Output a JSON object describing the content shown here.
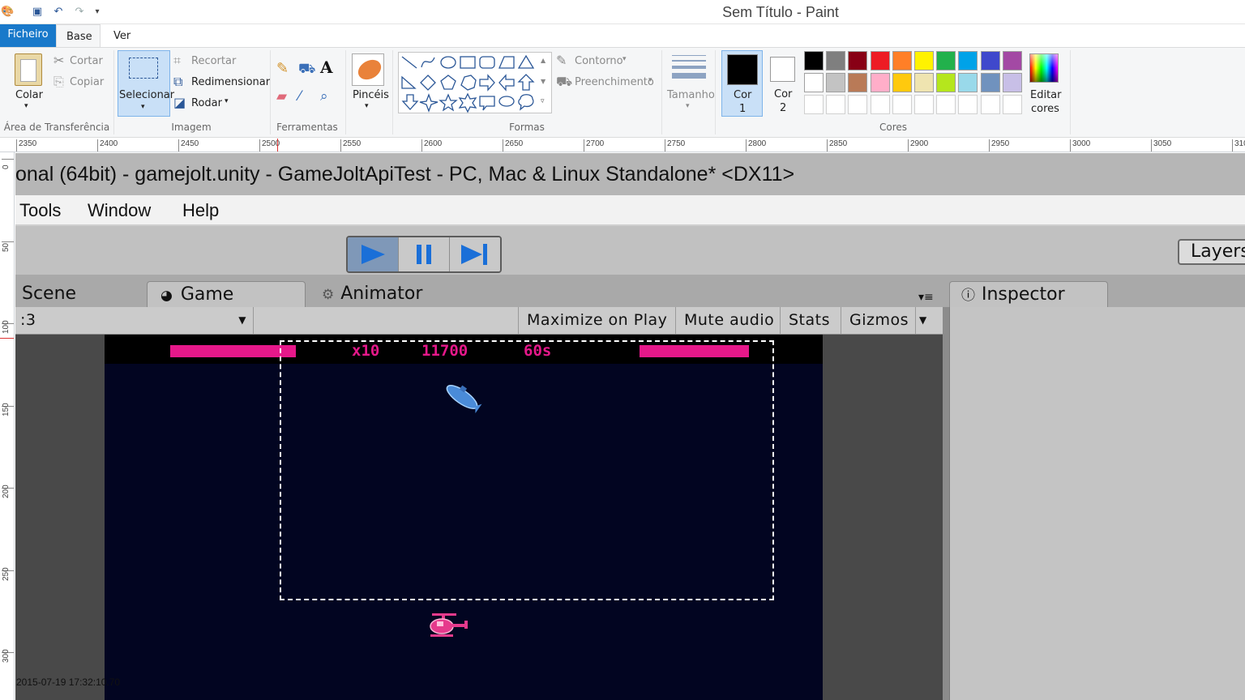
{
  "window": {
    "title": "Sem Título - Paint"
  },
  "ribbon_tabs": {
    "file": "Ficheiro",
    "home": "Base",
    "view": "Ver"
  },
  "clipboard": {
    "paste": "Colar",
    "cut": "Cortar",
    "copy": "Copiar",
    "group": "Área de Transferência"
  },
  "image": {
    "select": "Selecionar",
    "crop": "Recortar",
    "resize": "Redimensionar",
    "rotate": "Rodar",
    "group": "Imagem"
  },
  "tools": {
    "group": "Ferramentas"
  },
  "brushes": {
    "label": "Pincéis"
  },
  "shapes": {
    "outline": "Contorno",
    "fill": "Preenchimento",
    "group": "Formas"
  },
  "size": {
    "label": "Tamanho"
  },
  "colors": {
    "color1": "Cor\n1",
    "color1_a": "Cor",
    "color1_b": "1",
    "color2_a": "Cor",
    "color2_b": "2",
    "edit_a": "Editar",
    "edit_b": "cores",
    "group": "Cores",
    "color1_value": "#000000",
    "color2_value": "#ffffff",
    "row1": [
      "#000000",
      "#7f7f7f",
      "#880015",
      "#ed1c24",
      "#ff7f27",
      "#fff200",
      "#22b14c",
      "#00a2e8",
      "#3f48cc",
      "#a349a4"
    ],
    "row2": [
      "#ffffff",
      "#c3c3c3",
      "#b97a57",
      "#ffaec9",
      "#ffc90e",
      "#efe4b0",
      "#b5e61d",
      "#99d9ea",
      "#7092be",
      "#c8bfe7"
    ]
  },
  "ruler_h": [
    "2350",
    "2400",
    "2450",
    "2500",
    "2550",
    "2600",
    "2650",
    "2700",
    "2750",
    "2800",
    "2850",
    "2900",
    "2950",
    "3000",
    "3050",
    "310"
  ],
  "ruler_v": [
    "0",
    "50",
    "100",
    "150",
    "200",
    "250",
    "300"
  ],
  "unity": {
    "title": "onal (64bit) - gamejolt.unity - GameJoltApiTest - PC, Mac & Linux Standalone* <DX11>",
    "menu": {
      "tools": "Tools",
      "window": "Window",
      "help": "Help"
    },
    "layers": "Layers",
    "tabs": {
      "scene": "Scene",
      "game": "Game",
      "animator": "Animator",
      "inspector": "Inspector"
    },
    "aspect": ":3",
    "gamebar": {
      "maximize": "Maximize on Play",
      "mute": "Mute audio",
      "stats": "Stats",
      "gizmos": "Gizmos"
    }
  },
  "game": {
    "multiplier": "x10",
    "score": "11700",
    "timer": "60s"
  },
  "timestamp": "2015-07-19 17:32:10.70"
}
